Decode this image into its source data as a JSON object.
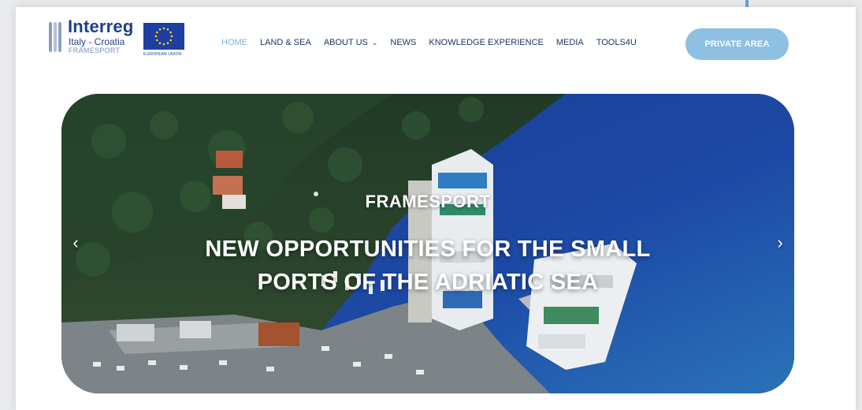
{
  "logo": {
    "name": "Interreg",
    "region": "Italy - Croatia",
    "project": "FRAMESPORT",
    "eu_caption": "EUROPEAN UNION",
    "mark_colors": [
      "#8e9bb8",
      "#b7c0d3",
      "#8aa1c9"
    ]
  },
  "nav": {
    "items": [
      {
        "label": "HOME",
        "active": true
      },
      {
        "label": "LAND & SEA",
        "active": false
      },
      {
        "label": "ABOUT US",
        "active": false,
        "dropdown": true
      },
      {
        "label": "NEWS",
        "active": false
      },
      {
        "label": "KNOWLEDGE EXPERIENCE",
        "active": false
      },
      {
        "label": "MEDIA",
        "active": false
      },
      {
        "label": "TOOLS4U",
        "active": false
      }
    ],
    "dropdown_icon": "chevron-down-icon"
  },
  "private_area": {
    "label": "PRIVATE AREA"
  },
  "hero": {
    "kicker": "FRAMESPORT",
    "title": "NEW OPPORTUNITIES FOR THE SMALL PORTS OF THE ADRIATIC SEA",
    "prev_icon": "chevron-left-icon",
    "next_icon": "chevron-right-icon",
    "prev_glyph": "‹",
    "next_glyph": "›"
  },
  "colors": {
    "accent": "#8dc0e3",
    "nav_text": "#1f3566",
    "active_nav": "#7fb2db",
    "brand_blue": "#1d3f8a",
    "sea": "#1a3d8e"
  }
}
